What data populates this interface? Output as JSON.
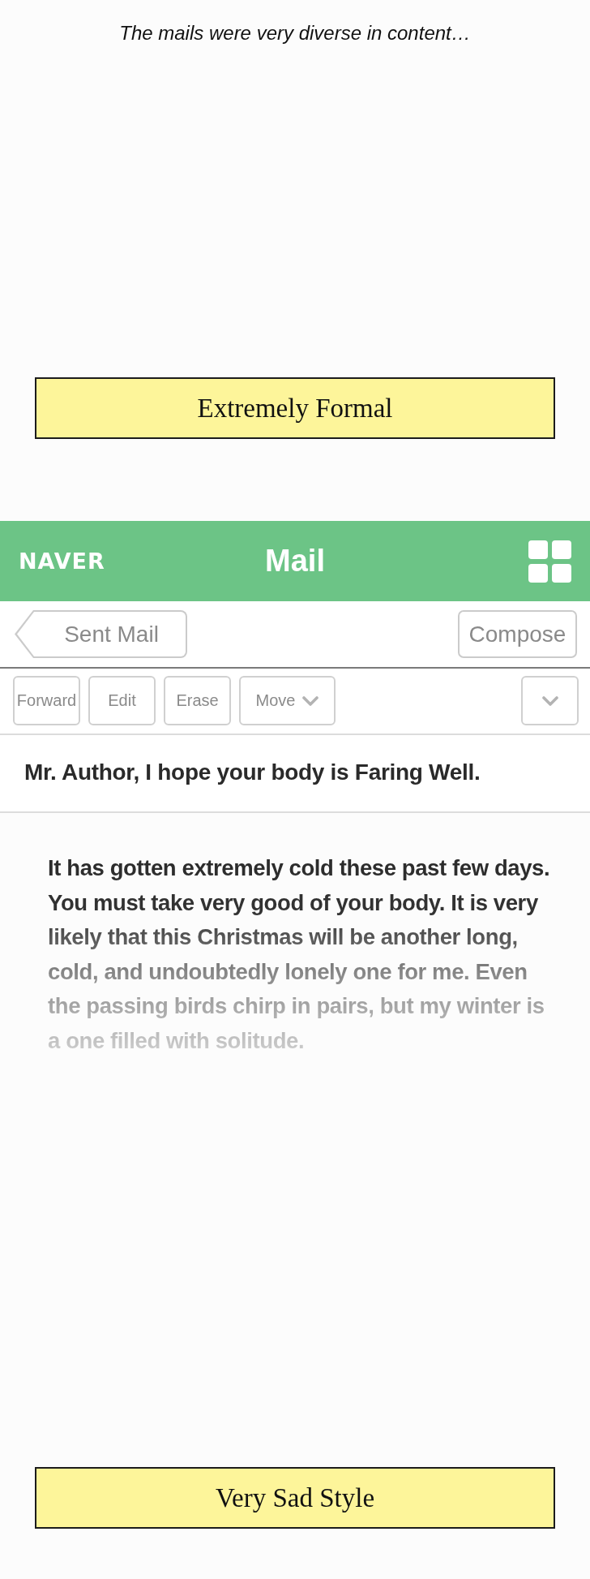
{
  "caption": "The mails were very diverse in content…",
  "top_label": "Extremely Formal",
  "mail_app": {
    "header": {
      "logo": "NAVER",
      "title": "Mail"
    },
    "nav": {
      "back_button": "Sent Mail",
      "compose_button": "Compose"
    },
    "toolbar": [
      {
        "kind": "button",
        "label": "Forward"
      },
      {
        "kind": "button",
        "label": "Edit"
      },
      {
        "kind": "button",
        "label": "Erase"
      },
      {
        "kind": "dropdown",
        "label": "Move"
      },
      {
        "kind": "more"
      }
    ],
    "subject": "Mr. Author, I hope your body is Faring Well.",
    "body": {
      "text": "It has gotten extremely cold these past few days.\nYou must take very good of your body. It is very\nlikely that this Christmas will be another long,\ncold, and undoubtedly lonely one for me. Even\nthe passing birds chirp in pairs, but my winter is\na one filled with solitude.",
      "faded": true
    }
  },
  "bottom_label": "Very Sad Style"
}
